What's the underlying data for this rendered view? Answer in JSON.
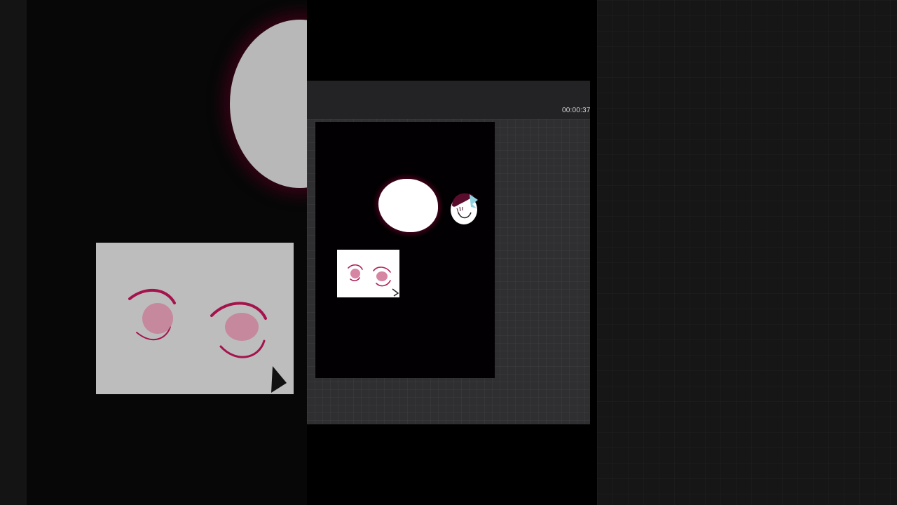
{
  "recording": {
    "elapsed_time": "00:00:37"
  },
  "canvas": {
    "background_color": "#020002",
    "elements": [
      "head-blob-white",
      "character-face-sketch",
      "eyes-reference-image"
    ]
  },
  "colors": {
    "app_background": "#2f2e30",
    "toolbar": "#232224",
    "eye_ink": "#b0205a",
    "accent_hair": "#8fd3e0"
  }
}
